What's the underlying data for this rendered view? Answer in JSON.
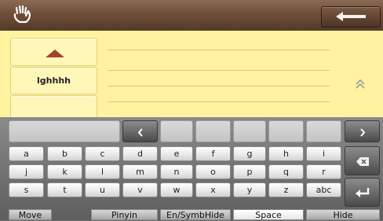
{
  "candidates": {
    "word": "lghhhh"
  },
  "rows": [
    [
      "a",
      "b",
      "c",
      "d",
      "e",
      "f",
      "g",
      "h",
      "i"
    ],
    [
      "j",
      "k",
      "l",
      "m",
      "n",
      "o",
      "p",
      "q",
      "r"
    ],
    [
      "s",
      "t",
      "u",
      "v",
      "w",
      "x",
      "y",
      "z",
      "abc"
    ]
  ],
  "bottom": [
    "Move",
    "Pinyin",
    "En/SymbHide",
    "Space",
    "Hide"
  ],
  "icons": {
    "hand": "hand-icon",
    "back": "left-arrow-icon",
    "page_up": "triangle-up-icon",
    "scroll_up": "double-chevron-up-icon",
    "cursor_left": "chevron-left-icon",
    "cursor_right": "chevron-right-icon",
    "backspace": "backspace-icon",
    "enter": "enter-icon"
  },
  "colors": {
    "topbar": "#6f4f3a",
    "panel": "#fff3a0",
    "triangle": "#a8412e",
    "keyboard": "#6e6e6e"
  }
}
